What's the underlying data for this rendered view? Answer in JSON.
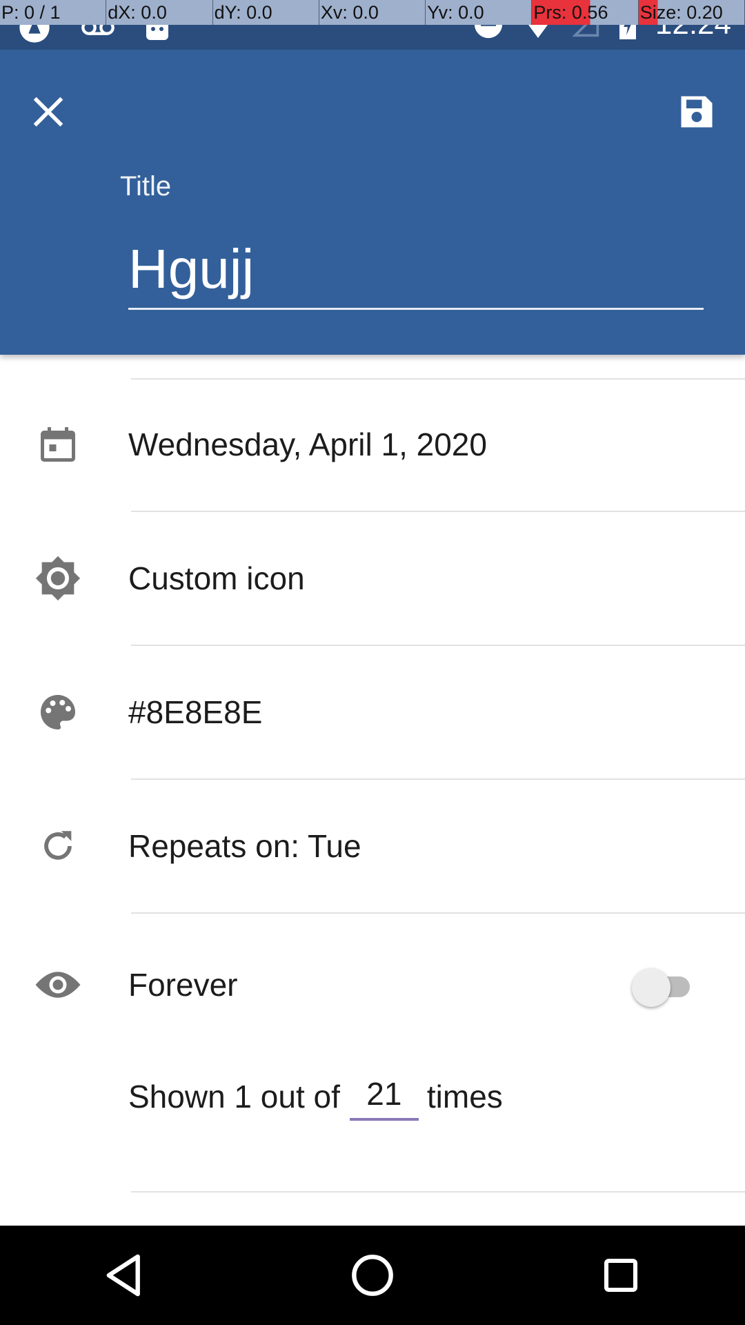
{
  "developer_overlay": {
    "cells": [
      "P: 0 / 1",
      "dX: 0.0",
      "dY: 0.0",
      "Xv: 0.0",
      "Yv: 0.0",
      "Prs: 0.56",
      "Size: 0.20"
    ]
  },
  "status_bar": {
    "clock": "12:24",
    "icons": [
      "app-notification-icon",
      "voicemail-icon",
      "android-debug-icon",
      "do-not-disturb-icon",
      "wifi-icon",
      "signal-icon",
      "battery-charging-icon"
    ]
  },
  "app_bar": {
    "close_icon": "close-icon",
    "save_icon": "save-icon",
    "title_label": "Title",
    "title_value": "Hgujj",
    "color": "#33609a"
  },
  "form": {
    "date": {
      "icon": "calendar-icon",
      "label": "Wednesday, April 1, 2020"
    },
    "custom_icon": {
      "icon": "gear-icon",
      "label": "Custom icon"
    },
    "color": {
      "icon": "palette-icon",
      "label": "#8E8E8E"
    },
    "repeat": {
      "icon": "repeat-icon",
      "label": "Repeats on: Tue"
    },
    "forever": {
      "icon": "eye-icon",
      "label": "Forever",
      "enabled": false
    },
    "shown": {
      "prefix": "Shown 1 out of",
      "count": "21",
      "suffix": "times"
    }
  },
  "nav_bar": {
    "buttons": [
      "back-icon",
      "home-icon",
      "recents-icon"
    ]
  }
}
